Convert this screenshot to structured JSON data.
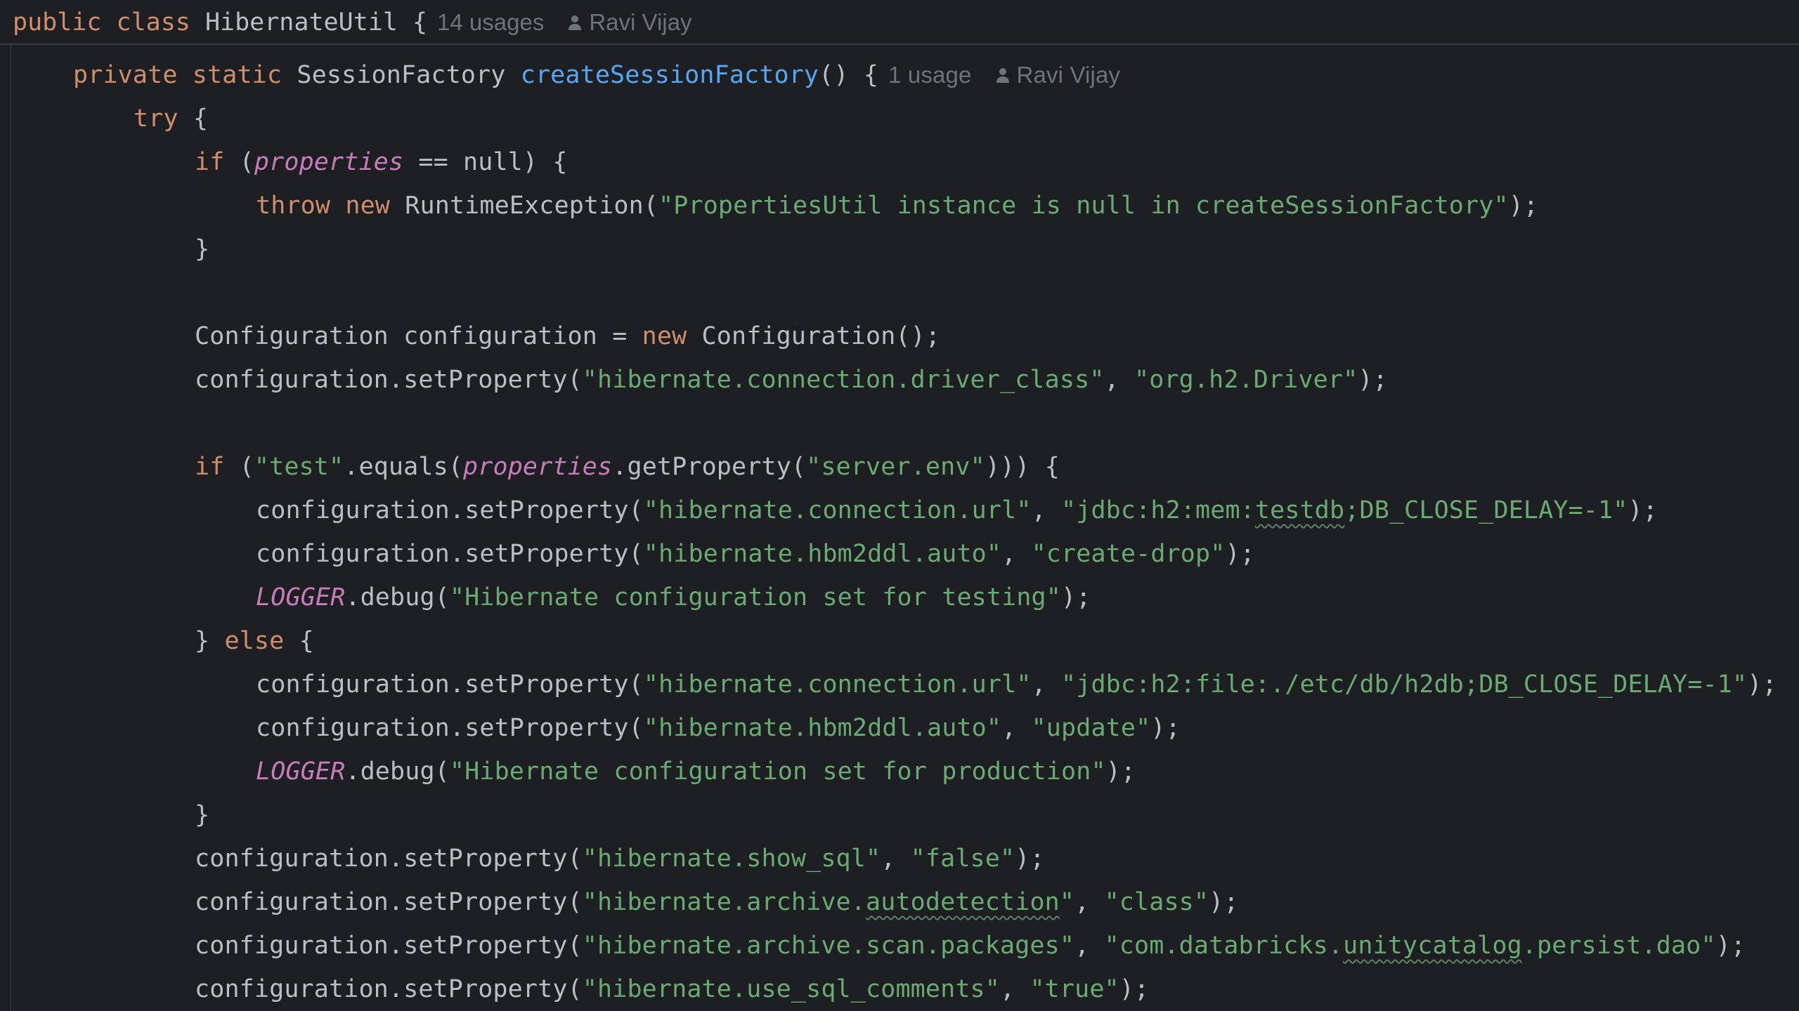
{
  "editor": {
    "sticky_header": {
      "kw_public": "public",
      "kw_class": "class",
      "class_name": "HibernateUtil",
      "brace": "{",
      "usages_hint": "14 usages",
      "author_hint": "Ravi Vijay"
    },
    "method": {
      "kw_private": "private",
      "kw_static": "static",
      "return_type": "SessionFactory",
      "name": "createSessionFactory",
      "params_brace": "() {",
      "usages_hint": "1 usage",
      "author_hint": "Ravi Vijay"
    },
    "lines": {
      "try_kw": "try",
      "try_brace": " {",
      "if1_kw": "if",
      "if1_open": " (",
      "if1_field": "properties",
      "if1_rest": " == null) {",
      "throw_kw": "throw",
      "throw_new": "new",
      "throw_ctor": "RuntimeException(",
      "throw_msg": "\"PropertiesUtil instance is null in createSessionFactory\"",
      "throw_end": ");",
      "close1": "}",
      "cfg_decl_a": "Configuration configuration = ",
      "cfg_decl_new": "new",
      "cfg_decl_b": " Configuration();",
      "set_prefix": "configuration.setProperty(",
      "comma": ", ",
      "set_end": ");",
      "driver_key": "\"hibernate.connection.driver_class\"",
      "driver_val": "\"org.h2.Driver\"",
      "if2_kw": "if",
      "if2_open": " (",
      "if2_test": "\"test\"",
      "if2_equals": ".equals(",
      "if2_field": "properties",
      "if2_get": ".getProperty(",
      "if2_key": "\"server.env\"",
      "if2_end": "))) {",
      "url_key": "\"hibernate.connection.url\"",
      "test_url_a": "\"jdbc:h2:mem:",
      "test_url_typo": "testdb",
      "test_url_b": ";DB_CLOSE_DELAY=-1\"",
      "hbm_key": "\"hibernate.hbm2ddl.auto\"",
      "hbm_test_val": "\"create-drop\"",
      "logger": "LOGGER",
      "debug_call": ".debug(",
      "debug_test_msg": "\"Hibernate configuration set for testing\"",
      "else_close": "} ",
      "else_kw": "else",
      "else_brace": " {",
      "prod_url_val": "\"jdbc:h2:file:./etc/db/h2db;DB_CLOSE_DELAY=-1\"",
      "hbm_prod_val": "\"update\"",
      "debug_prod_msg": "\"Hibernate configuration set for production\"",
      "close2": "}",
      "show_sql_key": "\"hibernate.show_sql\"",
      "show_sql_val": "\"false\"",
      "autodetect_key_a": "\"hibernate.archive.",
      "autodetect_key_typo": "autodetection",
      "autodetect_key_b": "\"",
      "autodetect_val": "\"class\"",
      "scan_key": "\"hibernate.archive.scan.packages\"",
      "scan_val_a": "\"com.databricks.",
      "scan_val_typo": "unitycatalog",
      "scan_val_b": ".persist.dao\"",
      "comments_key": "\"hibernate.use_sql_comments\"",
      "comments_val": "\"true\""
    }
  },
  "colors": {
    "background": "#1e1f22",
    "keyword": "#cf8e6d",
    "function": "#56a8f5",
    "string": "#6aab73",
    "field": "#c77dbb",
    "text": "#bcbec4",
    "hint": "#6f737a"
  },
  "icons": {
    "author": "person-icon"
  }
}
